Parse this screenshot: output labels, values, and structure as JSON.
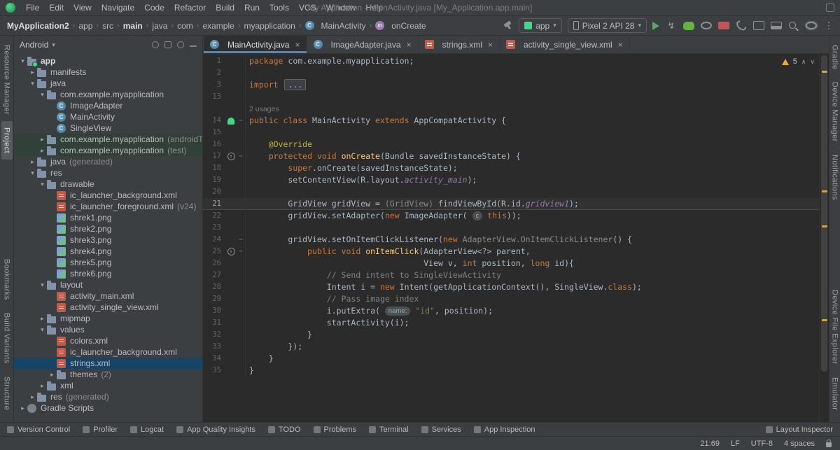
{
  "menu_bar": {
    "items": [
      "File",
      "Edit",
      "View",
      "Navigate",
      "Code",
      "Refactor",
      "Build",
      "Run",
      "Tools",
      "VCS",
      "Window",
      "Help"
    ],
    "window_title": "My Application - MainActivity.java [My_Application.app.main]"
  },
  "toolbar": {
    "breadcrumbs": [
      {
        "label": "MyApplication2",
        "bold": true
      },
      {
        "label": "app"
      },
      {
        "label": "src"
      },
      {
        "label": "main",
        "bold": true
      },
      {
        "label": "java"
      },
      {
        "label": "com"
      },
      {
        "label": "example"
      },
      {
        "label": "myapplication"
      },
      {
        "label": "MainActivity",
        "icon": "class"
      },
      {
        "label": "onCreate",
        "icon": "method"
      }
    ],
    "run_config": "app",
    "device": "Pixel 2 API 28",
    "icons_right": [
      "run",
      "apply-changes",
      "debug",
      "profile",
      "stop",
      "sync-project",
      "device-manager",
      "sdk-manager",
      "search",
      "settings",
      "more"
    ]
  },
  "left_stripe": {
    "top": [
      {
        "label": "Resource Manager"
      },
      {
        "label": "Project",
        "active": true
      }
    ],
    "bottom": [
      {
        "label": "Bookmarks"
      },
      {
        "label": "Build Variants"
      },
      {
        "label": "Structure"
      }
    ]
  },
  "right_stripe": {
    "top": [
      {
        "label": "Gradle"
      },
      {
        "label": "Device Manager"
      },
      {
        "label": "Notifications"
      }
    ],
    "bottom": [
      {
        "label": "Device File Explorer"
      },
      {
        "label": "Emulator"
      }
    ]
  },
  "project_panel": {
    "selector": "Android",
    "tree": [
      {
        "label": "app",
        "level": 0,
        "chevron": "open",
        "icon": "module",
        "bold": true
      },
      {
        "label": "manifests",
        "level": 1,
        "chevron": "closed",
        "icon": "folder"
      },
      {
        "label": "java",
        "level": 1,
        "chevron": "open",
        "icon": "folder"
      },
      {
        "label": "com.example.myapplication",
        "level": 2,
        "chevron": "open",
        "icon": "package"
      },
      {
        "label": "ImageAdapter",
        "level": 3,
        "icon": "class"
      },
      {
        "label": "MainActivity",
        "level": 3,
        "icon": "class"
      },
      {
        "label": "SingleView",
        "level": 3,
        "icon": "class"
      },
      {
        "label": "com.example.myapplication",
        "suffix": "(androidTest)",
        "level": 2,
        "chevron": "closed",
        "icon": "package",
        "test": true
      },
      {
        "label": "com.example.myapplication",
        "suffix": "(test)",
        "level": 2,
        "chevron": "closed",
        "icon": "package",
        "test": true
      },
      {
        "label": "java",
        "suffix": "(generated)",
        "level": 1,
        "chevron": "closed",
        "icon": "folder"
      },
      {
        "label": "res",
        "level": 1,
        "chevron": "open",
        "icon": "folder"
      },
      {
        "label": "drawable",
        "level": 2,
        "chevron": "open",
        "icon": "folder"
      },
      {
        "label": "ic_launcher_background.xml",
        "level": 3,
        "icon": "xml"
      },
      {
        "label": "ic_launcher_foreground.xml",
        "suffix": "(v24)",
        "level": 3,
        "icon": "xml"
      },
      {
        "label": "shrek1.png",
        "level": 3,
        "icon": "image"
      },
      {
        "label": "shrek2.png",
        "level": 3,
        "icon": "image"
      },
      {
        "label": "shrek3.png",
        "level": 3,
        "icon": "image"
      },
      {
        "label": "shrek4.png",
        "level": 3,
        "icon": "image"
      },
      {
        "label": "shrek5.png",
        "level": 3,
        "icon": "image"
      },
      {
        "label": "shrek6.png",
        "level": 3,
        "icon": "image"
      },
      {
        "label": "layout",
        "level": 2,
        "chevron": "open",
        "icon": "folder"
      },
      {
        "label": "activity_main.xml",
        "level": 3,
        "icon": "xml"
      },
      {
        "label": "activity_single_view.xml",
        "level": 3,
        "icon": "xml"
      },
      {
        "label": "mipmap",
        "level": 2,
        "chevron": "closed",
        "icon": "folder"
      },
      {
        "label": "values",
        "level": 2,
        "chevron": "open",
        "icon": "folder"
      },
      {
        "label": "colors.xml",
        "level": 3,
        "icon": "xml"
      },
      {
        "label": "ic_launcher_background.xml",
        "level": 3,
        "icon": "xml"
      },
      {
        "label": "strings.xml",
        "level": 3,
        "icon": "xml",
        "selected": true
      },
      {
        "label": "themes",
        "suffix": "(2)",
        "level": 3,
        "chevron": "closed",
        "icon": "folder"
      },
      {
        "label": "xml",
        "level": 2,
        "chevron": "closed",
        "icon": "folder"
      },
      {
        "label": "res",
        "suffix": "(generated)",
        "level": 1,
        "chevron": "closed",
        "icon": "folder"
      },
      {
        "label": "Gradle Scripts",
        "level": 0,
        "chevron": "closed",
        "icon": "gradle"
      }
    ]
  },
  "editor": {
    "tabs": [
      {
        "label": "MainActivity.java",
        "icon": "class",
        "active": true
      },
      {
        "label": "ImageAdapter.java",
        "icon": "class"
      },
      {
        "label": "strings.xml",
        "icon": "xml"
      },
      {
        "label": "activity_single_view.xml",
        "icon": "xml"
      }
    ],
    "inspections": {
      "warning_count": "5"
    },
    "lines": [
      {
        "n": "1",
        "t": [
          [
            "kw",
            "package"
          ],
          [
            "p",
            " com.example.myapplication;"
          ]
        ]
      },
      {
        "n": "2",
        "t": []
      },
      {
        "n": "3",
        "t": [
          [
            "kw",
            "import "
          ],
          [
            "fold",
            "..."
          ]
        ]
      },
      {
        "n": "13",
        "t": []
      },
      {
        "inlay": "2 usages"
      },
      {
        "n": "14",
        "gut": "android",
        "fold": true,
        "t": [
          [
            "kw",
            "public class"
          ],
          [
            "p",
            " MainActivity "
          ],
          [
            "kw",
            "extends"
          ],
          [
            "p",
            " AppCompatActivity {"
          ]
        ]
      },
      {
        "n": "15",
        "t": []
      },
      {
        "n": "16",
        "t": [
          [
            "p",
            "    "
          ],
          [
            "ann",
            "@Override"
          ]
        ]
      },
      {
        "n": "17",
        "gut": "override",
        "fold": true,
        "t": [
          [
            "p",
            "    "
          ],
          [
            "kw",
            "protected void"
          ],
          [
            "p",
            " "
          ],
          [
            "mtd",
            "onCreate"
          ],
          [
            "p",
            "(Bundle savedInstanceState) {"
          ]
        ]
      },
      {
        "n": "18",
        "t": [
          [
            "p",
            "        "
          ],
          [
            "kw",
            "super"
          ],
          [
            "p",
            ".onCreate(savedInstanceState);"
          ]
        ]
      },
      {
        "n": "19",
        "t": [
          [
            "p",
            "        setContentView(R.layout."
          ],
          [
            "fld",
            "activity_main"
          ],
          [
            "p",
            ");"
          ]
        ]
      },
      {
        "n": "20",
        "t": []
      },
      {
        "n": "21",
        "cur": true,
        "t": [
          [
            "p",
            "        GridView gridView = "
          ],
          [
            "gray",
            "(GridView)"
          ],
          [
            "p",
            " findViewById(R.id."
          ],
          [
            "fld",
            "gridview1"
          ],
          [
            "p",
            ");"
          ]
        ]
      },
      {
        "n": "22",
        "t": [
          [
            "p",
            "        gridView.setAdapter("
          ],
          [
            "kw",
            "new"
          ],
          [
            "p",
            " ImageAdapter( "
          ],
          [
            "hint",
            "c"
          ],
          [
            "p",
            " "
          ],
          [
            "kw",
            "this"
          ],
          [
            "p",
            "));"
          ]
        ]
      },
      {
        "n": "23",
        "t": []
      },
      {
        "n": "24",
        "fold": true,
        "t": [
          [
            "p",
            "        gridView.setOnItemClickListener("
          ],
          [
            "kw",
            "new"
          ],
          [
            "p",
            " "
          ],
          [
            "gray",
            "AdapterView.OnItemClickListener"
          ],
          [
            "p",
            "() {"
          ]
        ]
      },
      {
        "n": "25",
        "gut": "override",
        "fold": true,
        "t": [
          [
            "p",
            "            "
          ],
          [
            "kw",
            "public void"
          ],
          [
            "p",
            " "
          ],
          [
            "mtd",
            "onItemClick"
          ],
          [
            "p",
            "(AdapterView<?> parent,"
          ]
        ]
      },
      {
        "n": "26",
        "t": [
          [
            "p",
            "                                    View v, "
          ],
          [
            "kw",
            "int"
          ],
          [
            "p",
            " position, "
          ],
          [
            "kw",
            "long"
          ],
          [
            "p",
            " id){"
          ]
        ]
      },
      {
        "n": "27",
        "t": [
          [
            "p",
            "                "
          ],
          [
            "com",
            "// Send intent to SingleViewActivity"
          ]
        ]
      },
      {
        "n": "28",
        "t": [
          [
            "p",
            "                Intent i = "
          ],
          [
            "kw",
            "new"
          ],
          [
            "p",
            " Intent(getApplicationContext(), SingleView."
          ],
          [
            "kw",
            "class"
          ],
          [
            "p",
            ");"
          ]
        ]
      },
      {
        "n": "29",
        "t": [
          [
            "p",
            "                "
          ],
          [
            "com",
            "// Pass image index"
          ]
        ]
      },
      {
        "n": "30",
        "t": [
          [
            "p",
            "                i.putExtra( "
          ],
          [
            "hint",
            "name:"
          ],
          [
            "p",
            " "
          ],
          [
            "str",
            "\"id\""
          ],
          [
            "p",
            ", position);"
          ]
        ]
      },
      {
        "n": "31",
        "t": [
          [
            "p",
            "                startActivity(i);"
          ]
        ]
      },
      {
        "n": "32",
        "t": [
          [
            "p",
            "            }"
          ]
        ]
      },
      {
        "n": "33",
        "t": [
          [
            "p",
            "        });"
          ]
        ]
      },
      {
        "n": "34",
        "t": [
          [
            "p",
            "    }"
          ]
        ]
      },
      {
        "n": "35",
        "t": [
          [
            "p",
            "}"
          ]
        ]
      }
    ]
  },
  "bottom": {
    "tool_buttons": [
      "Version Control",
      "Profiler",
      "Logcat",
      "App Quality Insights",
      "TODO",
      "Problems",
      "Terminal",
      "Services",
      "App Inspection"
    ],
    "right_button": "Layout Inspector"
  },
  "status_bar": {
    "caret": "21:69",
    "line_separator": "LF",
    "encoding": "UTF-8",
    "indent": "4 spaces"
  },
  "colors": {
    "accent_blue": "#4a88c7",
    "warning_orange": "#f0a732",
    "selection_blue": "#164469",
    "run_green": "#59a869"
  }
}
